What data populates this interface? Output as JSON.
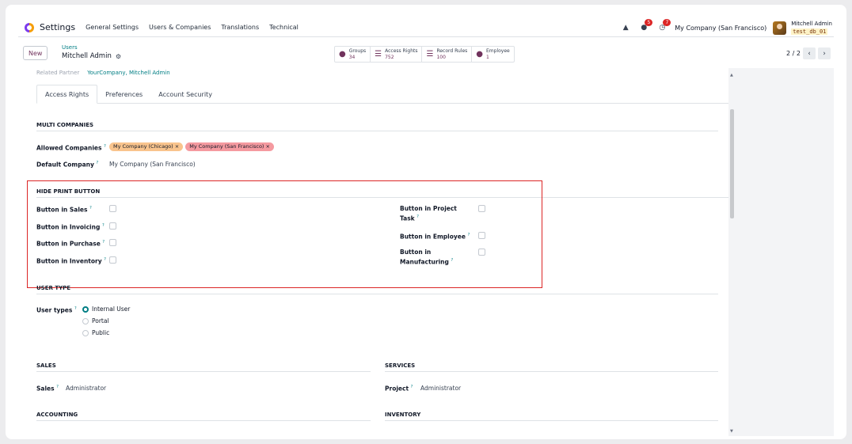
{
  "navbar": {
    "app_name": "Settings",
    "menus": [
      "General Settings",
      "Users & Companies",
      "Translations",
      "Technical"
    ],
    "messages_badge": "5",
    "activities_badge": "7",
    "company": "My Company (San Francisco)",
    "user_name": "Mitchell Admin",
    "db_name": "test_db_01"
  },
  "control": {
    "new_label": "New",
    "breadcrumb_parent": "Users",
    "breadcrumb_current": "Mitchell Admin",
    "smart_buttons": [
      {
        "label": "Groups",
        "value": "34"
      },
      {
        "label": "Access Rights",
        "value": "752"
      },
      {
        "label": "Record Rules",
        "value": "100"
      },
      {
        "label": "Employee",
        "value": "1"
      }
    ],
    "pager": "2 / 2"
  },
  "form": {
    "related_partner_label": "Related Partner",
    "related_partner_value": "YourCompany, Mitchell Admin",
    "tabs": [
      "Access Rights",
      "Preferences",
      "Account Security"
    ],
    "multi_companies": {
      "title": "MULTI COMPANIES",
      "allowed_label": "Allowed Companies",
      "allowed_tags": [
        "My Company (Chicago) ×",
        "My Company (San Francisco) ×"
      ],
      "default_label": "Default Company",
      "default_value": "My Company (San Francisco)"
    },
    "hide_print": {
      "title": "HIDE PRINT BUTTON",
      "left": [
        "Button in Sales",
        "Button in Invoicing",
        "Button in Purchase",
        "Button in Inventory"
      ],
      "right_1a": "Button in Project",
      "right_1b": "Task",
      "right_2": "Button in Employee",
      "right_3a": "Button in",
      "right_3b": "Manufacturing"
    },
    "user_type": {
      "title": "USER TYPE",
      "label": "User types",
      "options": [
        "Internal User",
        "Portal",
        "Public"
      ]
    },
    "sales": {
      "title": "SALES",
      "label": "Sales",
      "value": "Administrator"
    },
    "services": {
      "title": "SERVICES",
      "label": "Project",
      "value": "Administrator"
    },
    "accounting": {
      "title": "ACCOUNTING"
    },
    "inventory": {
      "title": "INVENTORY"
    },
    "help_mark": "?"
  },
  "colors": {
    "accent": "#017e84",
    "brand": "#71335d",
    "tag_chicago": "#f9c48d",
    "tag_sf": "#f59aa0",
    "highlight_box": "#dc2626"
  }
}
